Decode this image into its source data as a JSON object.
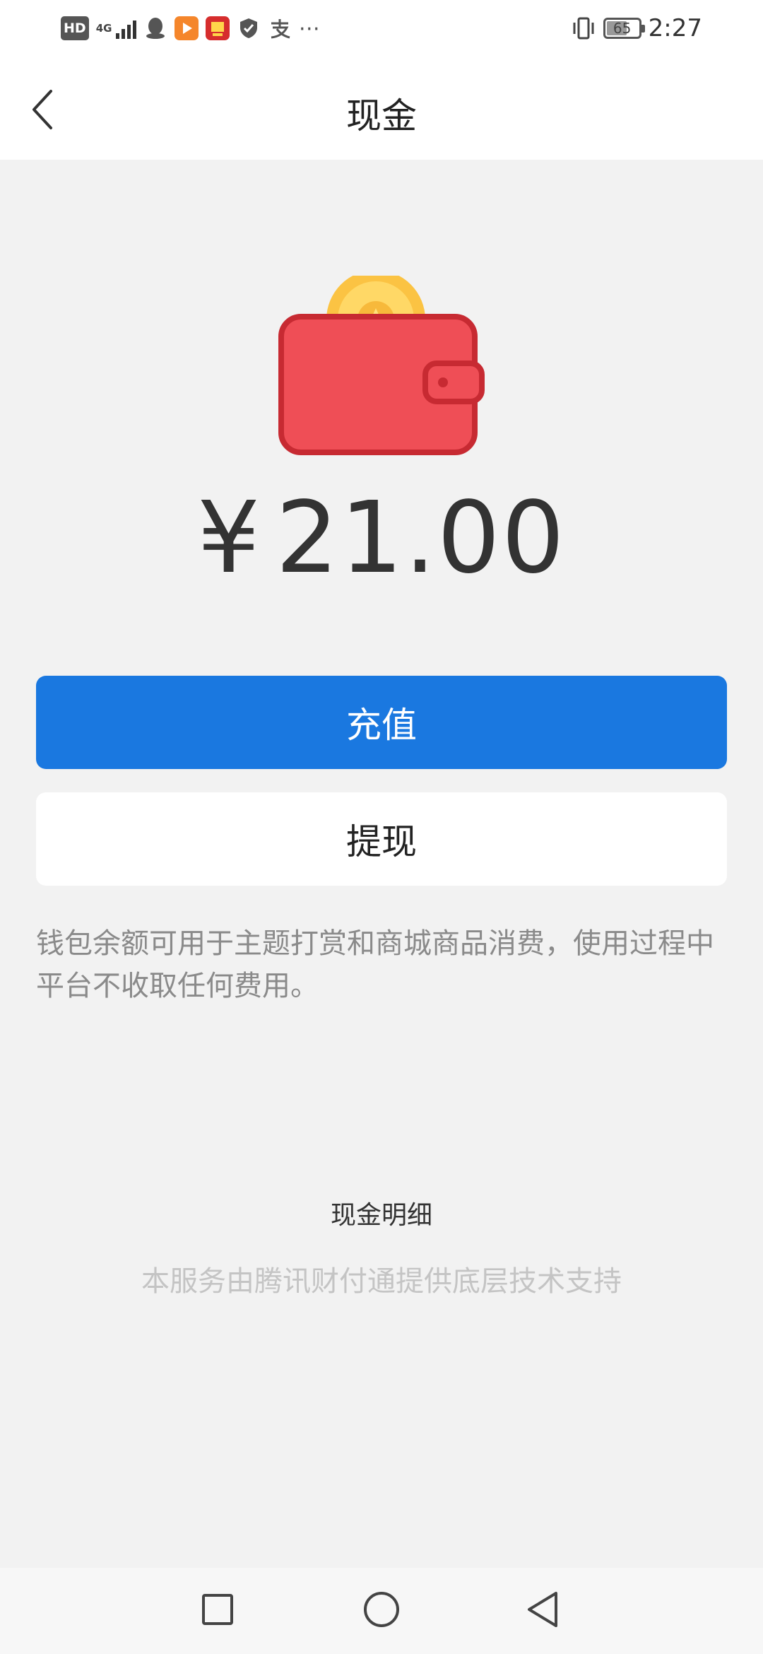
{
  "status_bar": {
    "hd_badge": "HD",
    "network_type": "4G",
    "battery_level": "65",
    "time": "2:27",
    "more_icon": "⋯",
    "icons": [
      "signal-icon",
      "qq-icon",
      "video-app-icon",
      "red-app-icon",
      "shield-icon",
      "alipay-icon",
      "vibrate-icon",
      "battery-icon"
    ]
  },
  "header": {
    "title": "现金",
    "back_icon": "chevron-left-icon"
  },
  "wallet": {
    "currency_symbol": "¥",
    "amount": "21.00",
    "icon": "wallet-coin-icon"
  },
  "actions": {
    "recharge_label": "充值",
    "withdraw_label": "提现"
  },
  "description": "钱包余额可用于主题打赏和商城商品消费，使用过程中平台不收取任何费用。",
  "footer": {
    "detail_link": "现金明细",
    "support_text": "本服务由腾讯财付通提供底层技术支持"
  },
  "colors": {
    "primary": "#1a78e0",
    "background": "#f2f2f2",
    "wallet_red": "#ef4e56",
    "coin_yellow": "#fbc343"
  },
  "system_nav": {
    "icons": [
      "recent-apps-icon",
      "home-icon",
      "back-icon"
    ]
  }
}
